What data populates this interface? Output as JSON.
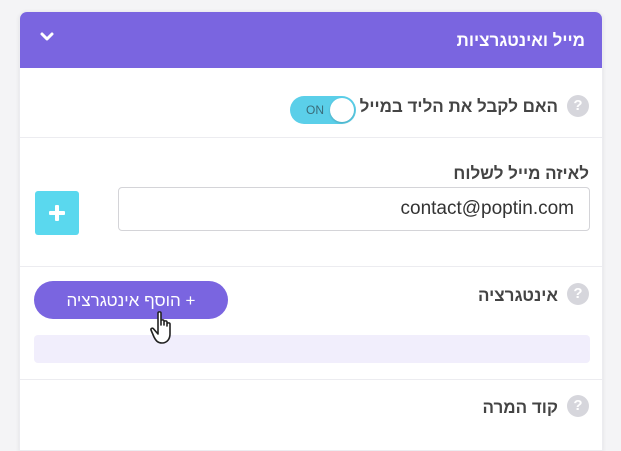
{
  "header": {
    "title": "מייל ואינטגרציות",
    "chevron_icon": "chevron-down-icon"
  },
  "rows": {
    "lead_email": {
      "label": "האם לקבל את הליד במייל",
      "help": "?",
      "toggle": {
        "state": "ON"
      }
    },
    "send_to": {
      "label": "לאיזה מייל לשלוח",
      "email_value": "contact@poptin.com"
    },
    "integration": {
      "label": "אינטגרציה",
      "help": "?",
      "add_button_label": "+ הוסף אינטגרציה"
    },
    "promo_code": {
      "label": "קוד המרה",
      "help": "?"
    }
  },
  "colors": {
    "accent": "#7a65e0",
    "toggle": "#5bcfe9",
    "add_button": "#5ad8ee"
  }
}
